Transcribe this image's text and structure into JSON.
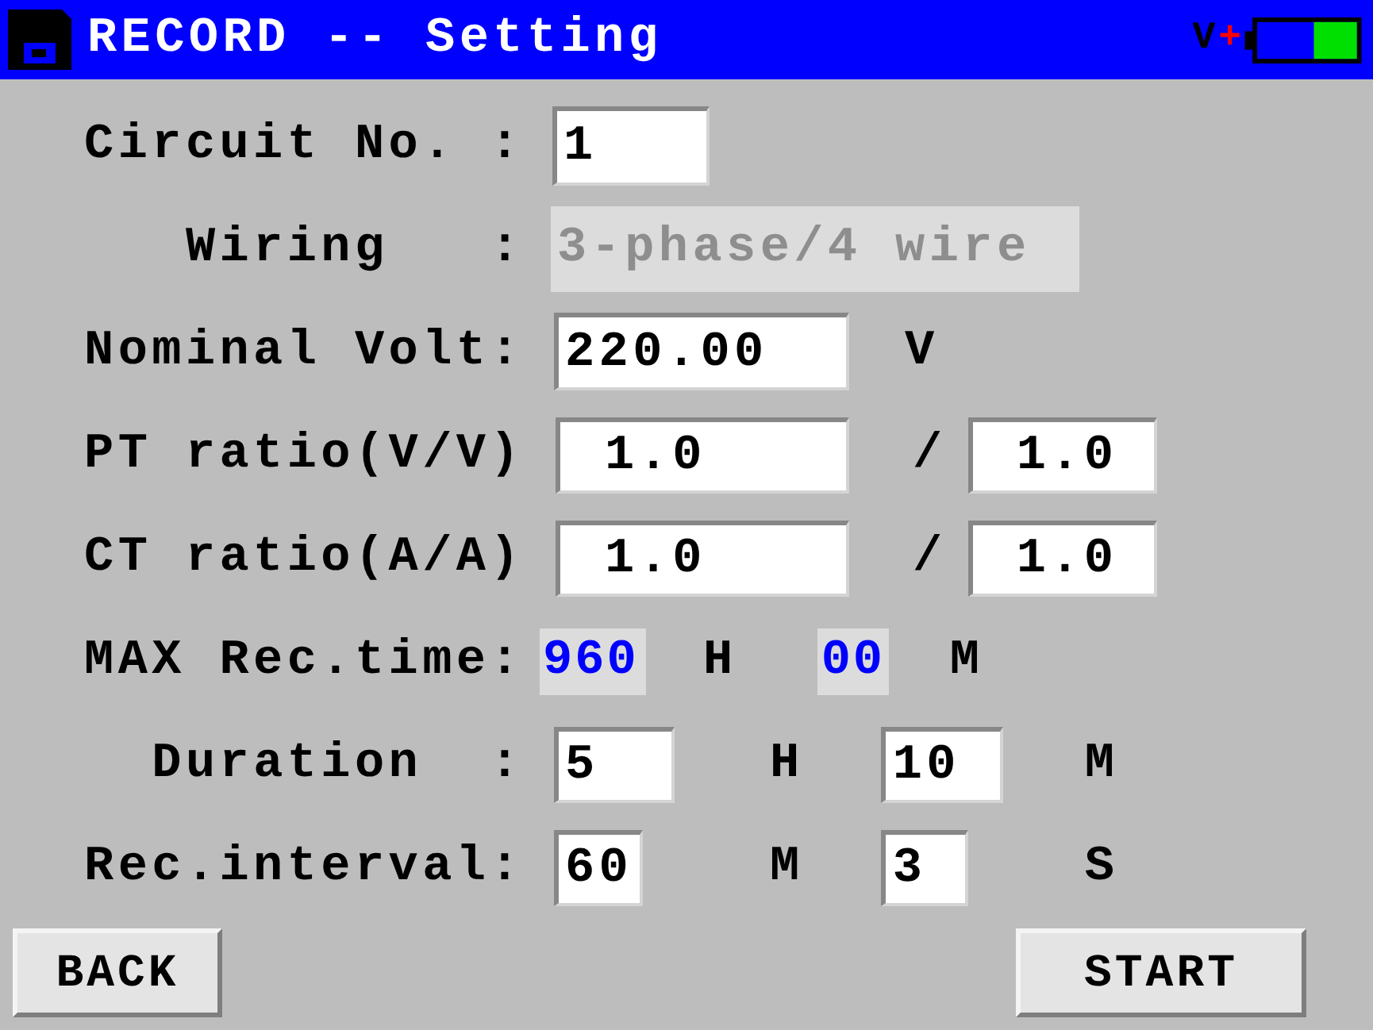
{
  "title_bar": {
    "title": "RECORD -- Setting",
    "power_label": "V",
    "power_sign": "+"
  },
  "rows": [
    {
      "label": "Circuit No. :",
      "items": [
        {
          "kind": "input",
          "value": "1",
          "disabled": false
        }
      ]
    },
    {
      "label": "Wiring   :",
      "items": [
        {
          "kind": "input",
          "value": "3-phase/4 wire",
          "disabled": true
        }
      ]
    },
    {
      "label": "Nominal Volt:",
      "items": [
        {
          "kind": "input",
          "value": "220.00",
          "disabled": false
        },
        {
          "kind": "unit",
          "text": "V"
        }
      ]
    },
    {
      "label": "PT ratio(V/V)",
      "items": [
        {
          "kind": "input",
          "value": "1.0",
          "disabled": false
        },
        {
          "kind": "separator",
          "text": "/"
        },
        {
          "kind": "input",
          "value": "1.0",
          "disabled": false
        }
      ]
    },
    {
      "label": "CT ratio(A/A)",
      "items": [
        {
          "kind": "input",
          "value": "1.0",
          "disabled": false
        },
        {
          "kind": "separator",
          "text": "/"
        },
        {
          "kind": "input",
          "value": "1.0",
          "disabled": false
        }
      ]
    },
    {
      "label": "MAX Rec.time:",
      "items": [
        {
          "kind": "display",
          "value": "960"
        },
        {
          "kind": "unit",
          "text": "H"
        },
        {
          "kind": "display",
          "value": "00"
        },
        {
          "kind": "unit",
          "text": "M"
        }
      ]
    },
    {
      "label": "Duration  :",
      "items": [
        {
          "kind": "input",
          "value": "5",
          "disabled": false
        },
        {
          "kind": "unit",
          "text": "H"
        },
        {
          "kind": "input",
          "value": "10",
          "disabled": false
        },
        {
          "kind": "unit",
          "text": "M"
        }
      ]
    },
    {
      "label": "Rec.interval:",
      "items": [
        {
          "kind": "input",
          "value": "60",
          "disabled": false
        },
        {
          "kind": "unit",
          "text": "M"
        },
        {
          "kind": "input",
          "value": "3",
          "disabled": false
        },
        {
          "kind": "unit",
          "text": "S"
        }
      ]
    }
  ],
  "buttons": [
    {
      "label": "BACK"
    },
    {
      "label": "START"
    }
  ]
}
